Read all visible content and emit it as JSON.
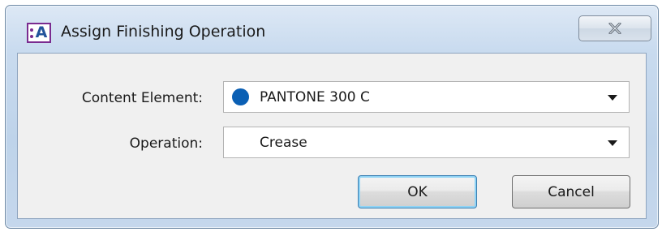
{
  "window": {
    "title": "Assign Finishing Operation",
    "app_icon_letter": "A",
    "icon": "app-icon",
    "close_icon": "close-icon"
  },
  "form": {
    "content_element": {
      "label": "Content Element:",
      "value": "PANTONE 300 C",
      "swatch_color": "#0a5fb4"
    },
    "operation": {
      "label": "Operation:",
      "value": "Crease"
    }
  },
  "buttons": {
    "ok_label": "OK",
    "cancel_label": "Cancel"
  }
}
